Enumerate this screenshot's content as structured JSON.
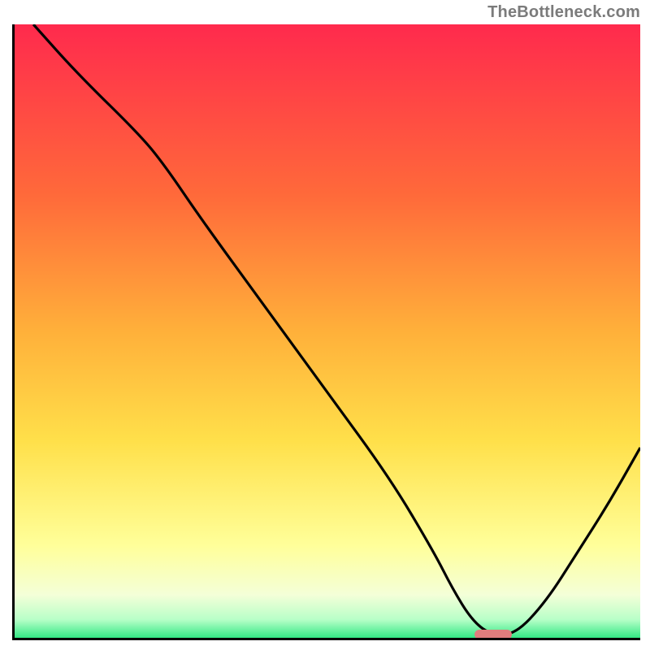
{
  "attribution": "TheBottleneck.com",
  "colors": {
    "axis": "#000000",
    "curve": "#000000",
    "marker": "#e07d7d",
    "gradient_top": "#ff2a4d",
    "gradient_mid_upper": "#ff9a33",
    "gradient_mid": "#ffd93a",
    "gradient_mid_lower": "#ffff9a",
    "gradient_low": "#f2ffda",
    "gradient_bottom": "#33e884"
  },
  "chart_data": {
    "type": "line",
    "title": "",
    "xlabel": "",
    "ylabel": "",
    "xlim": [
      0,
      100
    ],
    "ylim": [
      0,
      100
    ],
    "grid": false,
    "legend": false,
    "annotations": [],
    "series": [
      {
        "name": "curve",
        "x": [
          3,
          10,
          20,
          24,
          30,
          40,
          50,
          60,
          67,
          70,
          73,
          76,
          80,
          85,
          90,
          95,
          100
        ],
        "values": [
          100,
          92,
          82,
          77,
          68,
          54,
          40,
          26,
          14,
          8,
          3,
          0.5,
          0.5,
          6,
          14,
          22,
          31
        ]
      }
    ],
    "marker": {
      "x_start": 73.5,
      "x_end": 79.5,
      "y": 0.5
    }
  }
}
